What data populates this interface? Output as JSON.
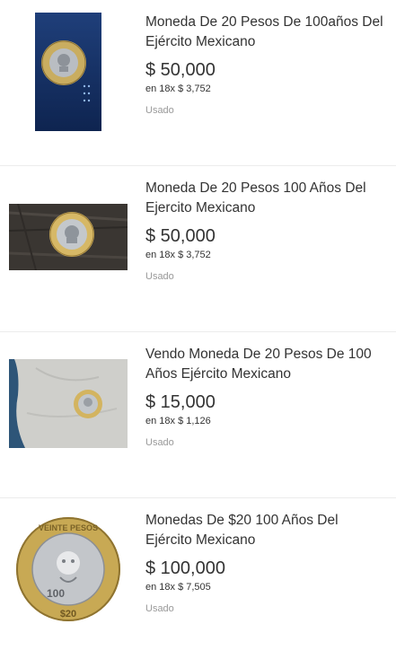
{
  "listings": [
    {
      "title": "Moneda De 20 Pesos De 100años Del Ejército Mexicano",
      "price": "$ 50,000",
      "installments": "en 18x $ 3,752",
      "condition": "Usado",
      "image_icon": "coin-photo-blue-background"
    },
    {
      "title": "Moneda De 20 Pesos 100 Años Del Ejercito Mexicano",
      "price": "$ 50,000",
      "installments": "en 18x $ 3,752",
      "condition": "Usado",
      "image_icon": "coin-photo-wood-background"
    },
    {
      "title": "Vendo Moneda De 20 Pesos De 100 Años Ejército Mexicano",
      "price": "$ 15,000",
      "installments": "en 18x $ 1,126",
      "condition": "Usado",
      "image_icon": "coin-photo-fabric-background"
    },
    {
      "title": "Monedas De $20 100 Años Del Ejército Mexicano",
      "price": "$ 100,000",
      "installments": "en 18x $ 7,505",
      "condition": "Usado",
      "image_icon": "coin-photo-white-background"
    }
  ],
  "coin_text": {
    "rim": "VEINTE PESOS",
    "denomination": "100",
    "value": "$20"
  }
}
